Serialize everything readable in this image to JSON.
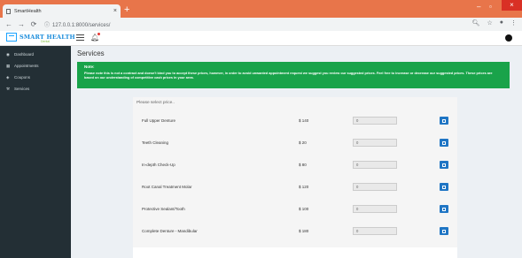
{
  "browser": {
    "tab_title": "SmartHealth",
    "tab_close": "×",
    "new_tab": "+",
    "minimize": "–",
    "maximize": "▫",
    "close": "×",
    "url": "127.0.0.1:8000/services/"
  },
  "header": {
    "logo_text": "SMART HEALTH",
    "logo_sub": "Dental"
  },
  "sidebar": {
    "items": [
      {
        "label": "Dashboard",
        "icon": "dashboard-icon"
      },
      {
        "label": "Appointments",
        "icon": "calendar-icon"
      },
      {
        "label": "Coupons",
        "icon": "tag-icon"
      },
      {
        "label": "Services",
        "icon": "wrench-icon"
      }
    ]
  },
  "main": {
    "title": "Services",
    "note_title": "Note:",
    "note_body": "Please note this is not a contract and doesn't bind you to accept these prices, however, in order to avoid unwanted appointment request we suggest you review our suggested prices. Feel free to increase or decrease our suggested prices. These prices are based on our understanding of competitive cash prices in your area.",
    "card_title": "Please select price..",
    "services": [
      {
        "name": "Full Upper Denture",
        "price": "$ 140",
        "input": "0"
      },
      {
        "name": "Teeth Cleaning",
        "price": "$ 20",
        "input": "0"
      },
      {
        "name": "In-depth Check-Up",
        "price": "$ 80",
        "input": "0"
      },
      {
        "name": "Root Canal Treatment Molar",
        "price": "$ 120",
        "input": "0"
      },
      {
        "name": "Protective Sealant/Tooth",
        "price": "$ 100",
        "input": "0"
      },
      {
        "name": "Complete Denture - Mandibular",
        "price": "$ 180",
        "input": "0"
      }
    ]
  },
  "colors": {
    "titlebar": "#e8754a",
    "sidebar": "#232f35",
    "note": "#19a34a",
    "button": "#1f75c4"
  }
}
